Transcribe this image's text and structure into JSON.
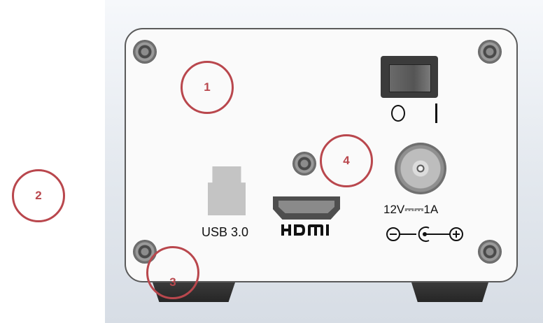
{
  "device": {
    "switch_symbols": {
      "off": "O",
      "on": "|"
    },
    "usb_label": "USB 3.0",
    "hdmi_label": "HDMI",
    "power_label": "12V⎓⎓1A",
    "polarity_symbol": "center-positive-polarity-icon"
  },
  "callouts": [
    "1",
    "2",
    "3",
    "4"
  ],
  "colors": {
    "callout": "#b9474d",
    "panel": "#fafafa",
    "feet": "#2e2e2e"
  }
}
